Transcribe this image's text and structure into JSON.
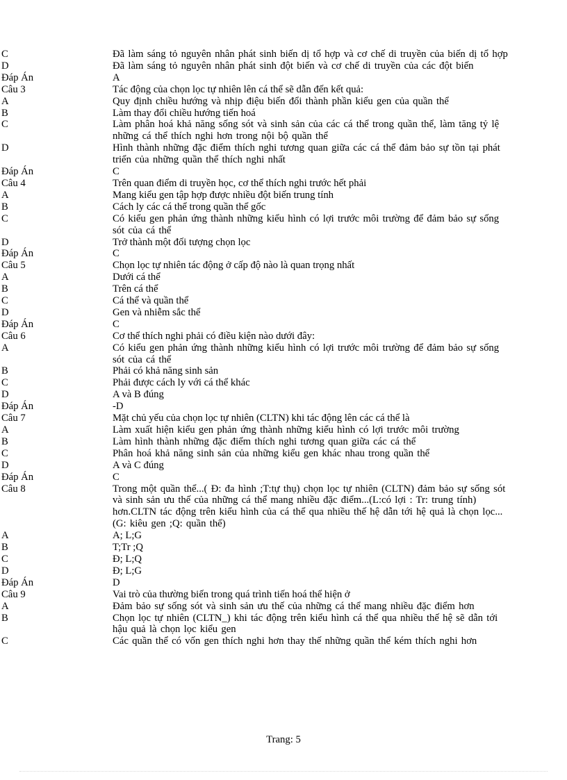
{
  "document": {
    "footer_label": "Trang:  5",
    "page_number": "5",
    "lines": [
      {
        "label": "C",
        "text": "Đã làm sáng tỏ nguyên nhân phát sinh biến dị tổ hợp và cơ chế di truyền của biến dị tổ hợp",
        "justify": true
      },
      {
        "label": "D",
        "text": "Đã làm sáng tỏ nguyên nhân phát sinh đột biến và cơ chế di truyền của các đột biến",
        "justify": true
      },
      {
        "label": "Đáp Án",
        "text": "A",
        "justify": false
      },
      {
        "label": "Câu 3",
        "text": "Tác động của chọn lọc tự nhiên lên cá thể sẽ dẫn đến kết quả:",
        "justify": false
      },
      {
        "label": "A",
        "text": "Quy định chiều hướng và nhịp điệu biến đổi thành phần kiểu gen của quần thể",
        "justify": true
      },
      {
        "label": "B",
        "text": "Làm thay đổi chiều hướng tiến hoá",
        "justify": false
      },
      {
        "label": "C",
        "text": "Làm phân hoá khả năng sống sót và sinh sản của các cá thể trong quần thể, làm tăng tỷ lệ những cá thể thích nghi hơn trong nội bộ quần thể",
        "justify": true
      },
      {
        "label": "D",
        "text": "Hình thành những đặc điểm thích nghi tương quan giữa các cá thể đảm bảo sự tồn tại phát triển của những quần thể thích nghi nhất",
        "justify": true
      },
      {
        "label": "Đáp Án",
        "text": "C",
        "justify": false
      },
      {
        "label": "Câu 4",
        "text": "Trên quan điểm di truyền học, cơ thể thích nghi trước hết phải",
        "justify": false
      },
      {
        "label": "A",
        "text": "Mang kiểu gen tập hợp được nhiều  đột biến trung tính",
        "justify": false
      },
      {
        "label": "B",
        "text": "Cách ly các cá thể trong quần thể gốc",
        "justify": false
      },
      {
        "label": "C",
        "text": "Có kiểu gen phản ứng thành những kiểu hình có lợi trước môi trường để đảm bảo sự sống sót của cá thể",
        "justify": true
      },
      {
        "label": "D",
        "text": "Trở thành một đối tượng chọn lọc",
        "justify": false
      },
      {
        "label": "Đáp Án",
        "text": "C",
        "justify": false
      },
      {
        "label": "Câu 5",
        "text": "Chọn lọc tự nhiên tác động ở cấp độ nào là quan trọng nhất",
        "justify": false
      },
      {
        "label": "A",
        "text": "Dưới cá thể",
        "justify": false
      },
      {
        "label": "B",
        "text": "Trên cá thể",
        "justify": false
      },
      {
        "label": "C",
        "text": "Cá thể và quần thể",
        "justify": false
      },
      {
        "label": "D",
        "text": "Gen và nhiễm  sắc thể",
        "justify": false
      },
      {
        "label": "Đáp Án",
        "text": "C",
        "justify": false
      },
      {
        "label": "Câu 6",
        "text": "Cơ thể thích nghi phải có điều kiện nào dưới đây:",
        "justify": false
      },
      {
        "label": "A",
        "text": "Có kiểu gen phản ứng thành những kiểu hình có lợi trước môi trường để đảm bảo sự sống sót của cá thể",
        "justify": true
      },
      {
        "label": "B",
        "text": "Phải có khả năng sinh sản",
        "justify": false
      },
      {
        "label": "C",
        "text": "Phải được cách ly với cá thể khác",
        "justify": false
      },
      {
        "label": "D",
        "text": "A và B đúng",
        "justify": false
      },
      {
        "label": "Đáp Án",
        "text": "-D",
        "justify": false
      },
      {
        "label": "Câu 7",
        "text": "Mặt chủ yếu của chọn lọc tự nhiên (CLTN) khi tác động lên các cá thể là",
        "justify": false
      },
      {
        "label": "A",
        "text": "Làm xuất hiện kiểu gen phản ứng thành những kiểu hình có lợi trước môi trường",
        "justify": true
      },
      {
        "label": "B",
        "text": "Làm hình thành những đặc điểm thích nghi tương quan giữa các cá thể",
        "justify": true
      },
      {
        "label": "C",
        "text": "Phân hoá khả năng sinh sản của những kiểu gen khác nhau trong quần thể",
        "justify": true
      },
      {
        "label": "D",
        "text": "A và C đúng",
        "justify": false
      },
      {
        "label": "Đáp Án",
        "text": "C",
        "justify": false
      },
      {
        "label": "Câu 8",
        "text": "Trong một quần thể...( Đ: đa hình ;T:tự thụ) chọn lọc tự nhiên (CLTN) đảm bảo sự sống sót và sinh sản ưu thế của những cá thể mang nhiều đặc điểm...(L:có lợi : Tr: trung tính) hơn.CLTN tác động trên kiểu hình của cá thể qua nhiều thế hệ dẫn tới hệ quả là chọn lọc... (G: kiêu gen ;Q: quần thể)",
        "justify": true
      },
      {
        "label": "A",
        "text": "A; L;G",
        "justify": false
      },
      {
        "label": "B",
        "text": "T;Tr ;Q",
        "justify": false
      },
      {
        "label": "C",
        "text": "Đ; L;Q",
        "justify": false
      },
      {
        "label": "D",
        "text": "Đ; L;G",
        "justify": false
      },
      {
        "label": "Đáp Án",
        "text": "D",
        "justify": false
      },
      {
        "label": "Câu 9",
        "text": "Vai trò của thường biến trong quá trình tiến hoá thể hiện ở",
        "justify": false
      },
      {
        "label": "A",
        "text": "Đảm bảo sự sống sót và sinh sản ưu thế của những cá thể mang nhiều đặc điểm hơn",
        "justify": true
      },
      {
        "label": "B",
        "text": "Chọn lọc tự nhiên (CLTN_) khi tác động trên kiểu hình cá thể qua nhiều thế hệ sẽ dẫn tới hậu quả là chọn lọc kiểu gen",
        "justify": true
      },
      {
        "label": "C",
        "text": "Các quần thể có vốn gen thích nghi hơn thay thế những quần thể kém thích nghi hơn",
        "justify": true
      }
    ]
  }
}
